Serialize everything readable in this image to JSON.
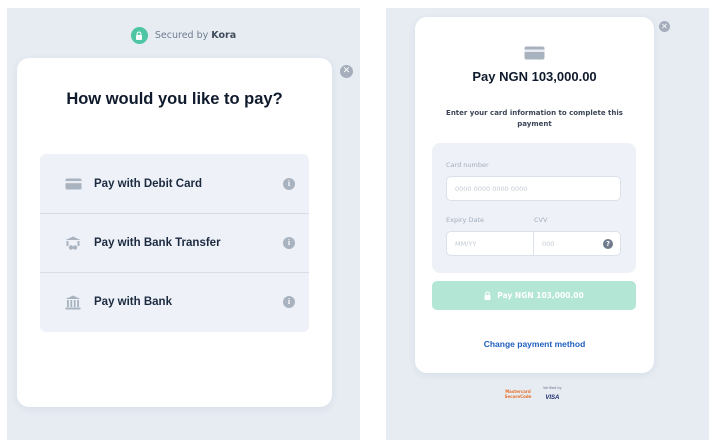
{
  "left": {
    "secured_prefix": "Secured by",
    "secured_brand": "Kora",
    "heading": "How would you like to pay?",
    "options": [
      {
        "label": "Pay with Debit Card",
        "icon": "card-icon"
      },
      {
        "label": "Pay with Bank Transfer",
        "icon": "bank-transfer-icon"
      },
      {
        "label": "Pay with Bank",
        "icon": "bank-icon"
      }
    ],
    "info_glyph": "i",
    "close_glyph": "✕"
  },
  "right": {
    "title": "Pay NGN 103,000.00",
    "subtitle": "Enter your card information to complete this payment",
    "card_number_label": "Card number",
    "card_number_placeholder": "0000 0000 0000 0000",
    "expiry_label": "Expiry Date",
    "expiry_placeholder": "MM/YY",
    "cvv_label": "CVV",
    "cvv_placeholder": "000",
    "help_glyph": "?",
    "pay_button": "Pay NGN 103,000.00",
    "change_method": "Change payment method",
    "badge_mastercard": "Mastercard SecureCode",
    "badge_verified_by": "Verified by",
    "badge_visa": "VISA",
    "close_glyph": "✕"
  },
  "colors": {
    "accent_green": "#4fc6a3",
    "pay_button_disabled": "#b4e6d6",
    "link_blue": "#1f5fbf",
    "panel_bg": "#e7ecf3"
  }
}
